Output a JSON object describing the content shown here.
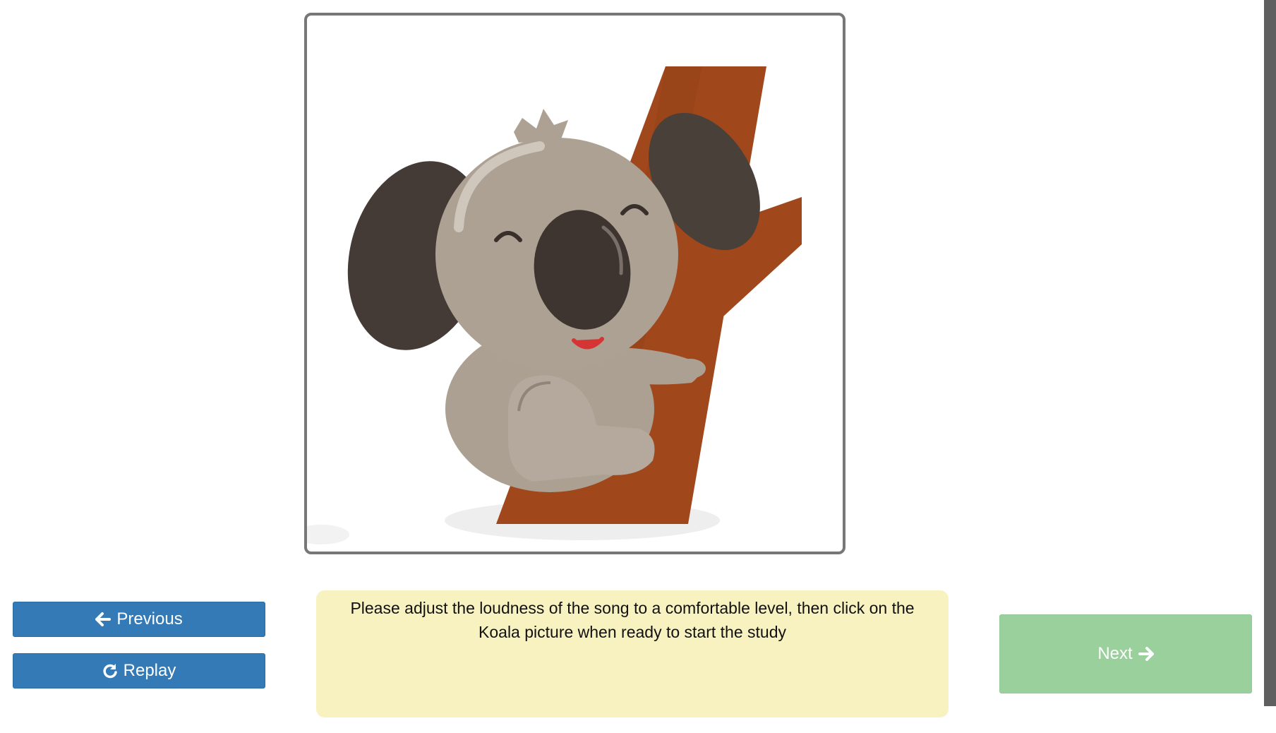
{
  "picture": {
    "alt": "Koala picture",
    "icon": "koala-hugging-tree-illustration"
  },
  "nav": {
    "previous_label": "Previous",
    "previous_icon": "arrow-left-icon",
    "replay_label": "Replay",
    "replay_icon": "rotate-right-icon",
    "next_label": "Next",
    "next_icon": "arrow-right-icon"
  },
  "instructions": {
    "text": "Please adjust the loudness of the song to a comfortable level, then click on the Koala picture when ready to start the study"
  },
  "colors": {
    "primary_button": "#337ab7",
    "next_button": "#9ad09b",
    "instructions_background": "#f8f2c0",
    "frame_border": "#777777"
  }
}
